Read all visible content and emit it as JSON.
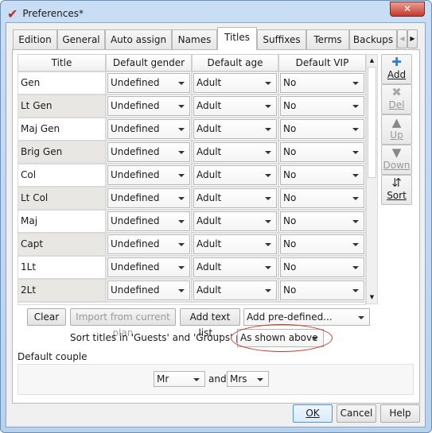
{
  "window": {
    "title": "Preferences*",
    "close": "✕"
  },
  "tabs": [
    "Edition",
    "General",
    "Auto assign",
    "Names",
    "Titles",
    "Suffixes",
    "Terms",
    "Backups"
  ],
  "active_tab": "Titles",
  "table": {
    "columns": [
      "Title",
      "Default gender",
      "Default age",
      "Default VIP"
    ],
    "rows": [
      [
        "Gen",
        "Undefined",
        "Adult",
        "No"
      ],
      [
        "Lt Gen",
        "Undefined",
        "Adult",
        "No"
      ],
      [
        "Maj Gen",
        "Undefined",
        "Adult",
        "No"
      ],
      [
        "Brig Gen",
        "Undefined",
        "Adult",
        "No"
      ],
      [
        "Col",
        "Undefined",
        "Adult",
        "No"
      ],
      [
        "Lt Col",
        "Undefined",
        "Adult",
        "No"
      ],
      [
        "Maj",
        "Undefined",
        "Adult",
        "No"
      ],
      [
        "Capt",
        "Undefined",
        "Adult",
        "No"
      ],
      [
        "1Lt",
        "Undefined",
        "Adult",
        "No"
      ],
      [
        "2Lt",
        "Undefined",
        "Adult",
        "No"
      ]
    ]
  },
  "side_buttons": [
    {
      "label": "Add",
      "icon": "plus-icon",
      "enabled": true
    },
    {
      "label": "Del",
      "icon": "x-icon",
      "enabled": false
    },
    {
      "label": "Up",
      "icon": "up-arrow-icon",
      "enabled": false
    },
    {
      "label": "Down",
      "icon": "down-arrow-icon",
      "enabled": false
    },
    {
      "label": "Sort",
      "icon": "sort-icon",
      "enabled": true
    }
  ],
  "actions": {
    "clear": "Clear",
    "import": "Import from current plan",
    "add_text_list": "Add text list...",
    "add_predefined": "Add pre-defined..."
  },
  "sort": {
    "label": "Sort titles in 'Guests' and 'Groups' panes:",
    "value": "As shown above",
    "highlight_color": "#c0392b"
  },
  "couple": {
    "label": "Default couple",
    "first": "Mr",
    "and": "and",
    "second": "Mrs"
  },
  "footer": {
    "ok": "OK",
    "cancel": "Cancel",
    "help": "Help"
  }
}
